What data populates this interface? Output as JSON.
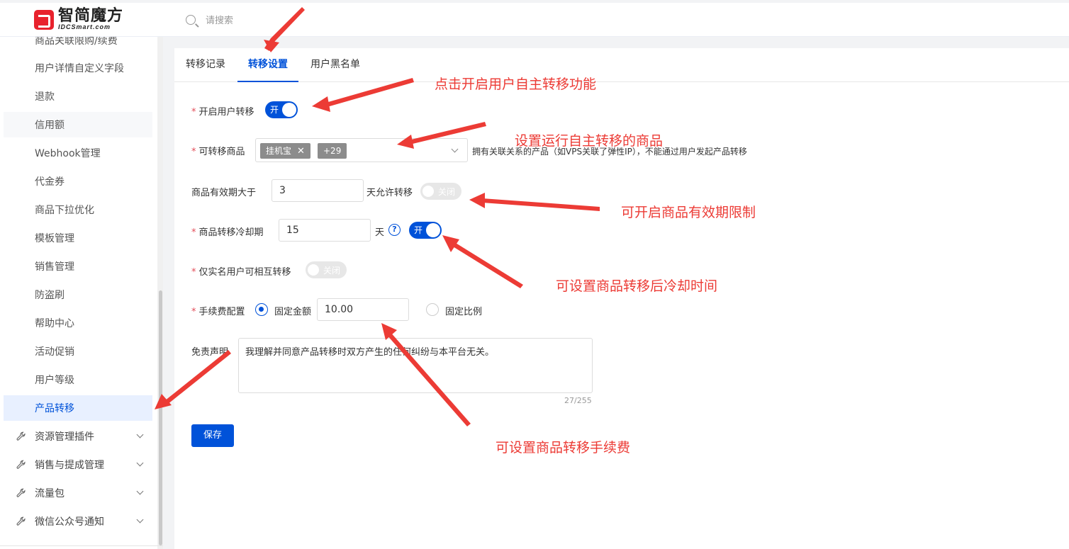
{
  "header": {
    "logo_main": "智简魔方",
    "logo_sub": "IDCSmart.com",
    "search_placeholder": "请搜索"
  },
  "sidebar": {
    "items": [
      {
        "label": "商品关联限购/续费"
      },
      {
        "label": "用户详情自定义字段"
      },
      {
        "label": "退款"
      },
      {
        "label": "信用额"
      },
      {
        "label": "Webhook管理"
      },
      {
        "label": "代金券"
      },
      {
        "label": "商品下拉优化"
      },
      {
        "label": "模板管理"
      },
      {
        "label": "销售管理"
      },
      {
        "label": "防盗刷"
      },
      {
        "label": "帮助中心"
      },
      {
        "label": "活动促销"
      },
      {
        "label": "用户等级"
      },
      {
        "label": "产品转移"
      }
    ],
    "groups": [
      {
        "label": "资源管理插件"
      },
      {
        "label": "销售与提成管理"
      },
      {
        "label": "流量包"
      },
      {
        "label": "微信公众号通知"
      }
    ]
  },
  "tabs": [
    {
      "label": "转移记录"
    },
    {
      "label": "转移设置"
    },
    {
      "label": "用户黑名单"
    }
  ],
  "form": {
    "enable_transfer": {
      "label": "开启用户转移",
      "toggle_on_text": "开"
    },
    "transferable_products": {
      "label": "可转移商品",
      "tag": "挂机宝",
      "more_tag": "+29",
      "note": "拥有关联关系的产品（如VPS关联了弹性IP），不能通过用户发起产品转移"
    },
    "validity": {
      "label": "商品有效期大于",
      "value": "3",
      "suffix": "天允许转移",
      "toggle_off_text": "关闭"
    },
    "cooldown": {
      "label": "商品转移冷却期",
      "value": "15",
      "suffix": "天",
      "help": "?",
      "toggle_on_text": "开"
    },
    "realname_only": {
      "label": "仅实名用户可相互转移",
      "toggle_off_text": "关闭"
    },
    "fee": {
      "label": "手续费配置",
      "fixed_label": "固定金额",
      "fixed_value": "10.00",
      "ratio_label": "固定比例"
    },
    "disclaimer": {
      "label": "免责声明",
      "value": "我理解并同意产品转移时双方产生的任何纠纷与本平台无关。",
      "counter": "27/255"
    },
    "save_label": "保存"
  },
  "annotations": {
    "a1": "点击开启用户自主转移功能",
    "a2": "设置运行自主转移的商品",
    "a3": "可开启商品有效期限制",
    "a4": "可设置商品转移后冷却时间",
    "a5": "可设置商品转移手续费"
  },
  "colors": {
    "primary": "#0052d9",
    "annotation": "#ec3b35",
    "logo": "#e8222d"
  }
}
